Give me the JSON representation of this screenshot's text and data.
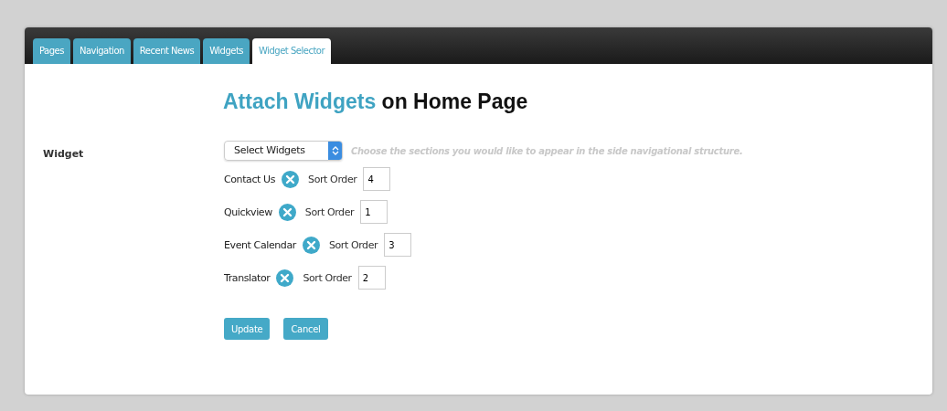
{
  "tabs": [
    {
      "label": "Pages",
      "selected": false
    },
    {
      "label": "Navigation",
      "selected": false
    },
    {
      "label": "Recent News",
      "selected": false
    },
    {
      "label": "Widgets",
      "selected": false
    },
    {
      "label": "Widget Selector",
      "selected": true
    }
  ],
  "heading": {
    "highlight": "Attach Widgets",
    "rest": "on Home Page"
  },
  "field_label": "Widget",
  "select": {
    "value": "Select Widgets"
  },
  "hint": "Choose the sections you would like to appear in the side navigational structure.",
  "widgets": [
    {
      "name": "Contact Us",
      "sort_label": "Sort Order",
      "sort_value": "4"
    },
    {
      "name": "Quickview",
      "sort_label": "Sort Order",
      "sort_value": "1"
    },
    {
      "name": "Event Calendar",
      "sort_label": "Sort Order",
      "sort_value": "3"
    },
    {
      "name": "Translator",
      "sort_label": "Sort Order",
      "sort_value": "2"
    }
  ],
  "buttons": [
    "Update",
    "Cancel"
  ]
}
